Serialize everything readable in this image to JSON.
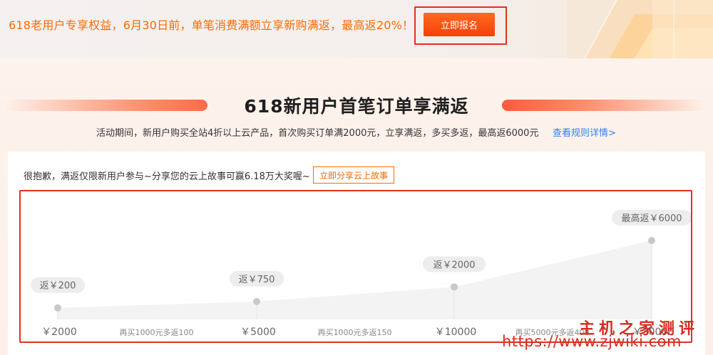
{
  "banner": {
    "text": "618老用户专享权益，6月30日前，单笔消费满额立享新购满返，最高返20%！",
    "signup_label": "立即报名"
  },
  "section": {
    "title": "618新用户首笔订单享满返",
    "subtitle": "活动期间，新用户购买全站4折以上云产品，首次购买订单满2000元，立享满返，多买多返，最高返6000元",
    "rules_link": "查看规则详情>"
  },
  "card": {
    "note": "很抱歉，满返仅限新用户参与~分享您的云上故事可赢6.18万大奖喔~",
    "story_button": "立即分享云上故事"
  },
  "chart_data": {
    "type": "area",
    "points": [
      {
        "spend": "￥2000",
        "rebate": "返￥200",
        "value": 200
      },
      {
        "spend": "￥5000",
        "rebate": "返￥750",
        "value": 750
      },
      {
        "spend": "￥10000",
        "rebate": "返￥2000",
        "value": 2000
      },
      {
        "spend": "￥30000",
        "rebate": "最高返￥6000",
        "value": 6000
      }
    ],
    "steps": [
      "再买1000元多返100",
      "再买1000元多返150",
      "再买5000元多返400"
    ],
    "colors": {
      "area": "#f3f3f3",
      "marker": "#c8c8c8",
      "label_bg": "#ededed",
      "text": "#666666"
    }
  },
  "watermark": {
    "line1": "主机之家测评",
    "url": "https://www.zjwiki.com"
  }
}
